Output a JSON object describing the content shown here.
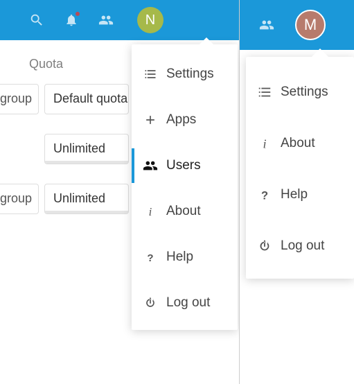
{
  "left": {
    "quota_heading": "Quota",
    "rows": [
      {
        "group": "group",
        "quota": "Default quota"
      },
      {
        "group": "",
        "quota": "Unlimited"
      },
      {
        "group": "group",
        "quota": "Unlimited"
      }
    ],
    "avatar_initial": "N",
    "menu": [
      {
        "key": "settings",
        "label": "Settings"
      },
      {
        "key": "apps",
        "label": "Apps"
      },
      {
        "key": "users",
        "label": "Users",
        "active": true
      },
      {
        "key": "about",
        "label": "About"
      },
      {
        "key": "help",
        "label": "Help"
      },
      {
        "key": "logout",
        "label": "Log out"
      }
    ]
  },
  "right": {
    "avatar_initial": "M",
    "menu": [
      {
        "key": "settings",
        "label": "Settings"
      },
      {
        "key": "about",
        "label": "About"
      },
      {
        "key": "help",
        "label": "Help"
      },
      {
        "key": "logout",
        "label": "Log out"
      }
    ]
  }
}
